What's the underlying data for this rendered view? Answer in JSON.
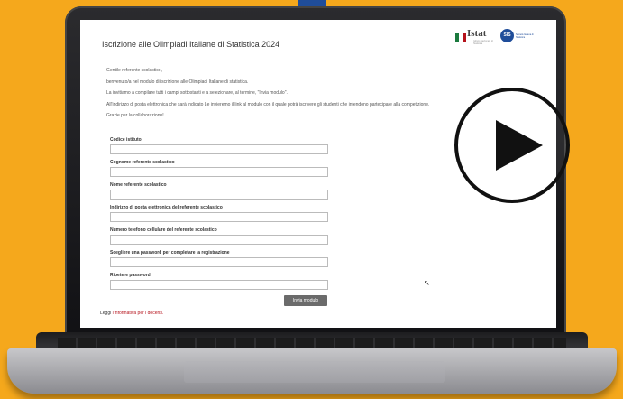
{
  "page": {
    "title": "Iscrizione alle Olimpiadi Italiane di Statistica 2024",
    "logo_istat": "Istat",
    "logo_istat_sub": "Istituto Nazionale di Statistica",
    "logo_sis": "SIS",
    "logo_sis_sub": "Società Italiana di Statistica"
  },
  "intro": {
    "lines": [
      "Gentile referente scolastico,",
      "benvenuto/a nel modulo di iscrizione alle Olimpiadi Italiane di statistica.",
      "La invitiamo a compilare tutti i campi sottostanti e a selezionare, al termine, \"Invia modulo\".",
      "All'indirizzo di posta elettronica che sarà indicato Le invieremo il link al modulo con il quale potrà iscrivere gli studenti che intendono partecipare alla competizione.",
      "Grazie per la collaborazione!"
    ]
  },
  "form": {
    "fields": [
      {
        "label": "Codice istituto",
        "value": ""
      },
      {
        "label": "Cognome referente scolastico",
        "value": ""
      },
      {
        "label": "Nome referente scolastico",
        "value": ""
      },
      {
        "label": "Indirizzo di posta elettronica del referente scolastico",
        "value": ""
      },
      {
        "label": "Numero telefono cellulare del referente scolastico",
        "value": ""
      },
      {
        "label": "Scegliere una password per completare la registrazione",
        "value": ""
      },
      {
        "label": "Ripetere password",
        "value": ""
      }
    ],
    "submit_label": "Invia modulo"
  },
  "footer": {
    "prefix": "Leggi ",
    "link_text": "l'informativa per i docenti."
  },
  "colors": {
    "background": "#f5a81c",
    "accent_blue": "#1f4d9a",
    "link_red": "#b5121b",
    "submit_button": "#6b6b6b"
  },
  "icons": {
    "play_overlay": "play-icon",
    "cursor": "mouse-pointer-icon"
  }
}
